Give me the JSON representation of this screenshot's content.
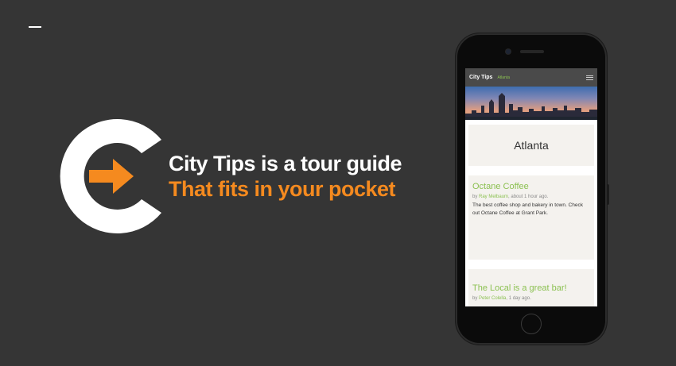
{
  "tagline": {
    "line1": "City Tips is a tour guide",
    "line2": "That fits in your pocket"
  },
  "colors": {
    "background": "#353535",
    "accent_orange": "#f58a1f",
    "accent_green": "#8cc152",
    "logo_white": "#ffffff"
  },
  "phone": {
    "app": {
      "brand": "City Tips",
      "city_link": "Atlanta",
      "menu_icon": "hamburger-menu-icon"
    },
    "page_title": "Atlanta",
    "posts": [
      {
        "title": "Octane Coffee",
        "by": "by ",
        "author": "Ray Melbaum",
        "time": ", about 1 hour ago.",
        "body": "The best coffee shop and bakery in town. Check out Octane Coffee at Grant Park."
      },
      {
        "title": "The Local is a great bar!",
        "by": "by ",
        "author": "Peter Colella",
        "time": ", 1 day ago."
      }
    ]
  }
}
